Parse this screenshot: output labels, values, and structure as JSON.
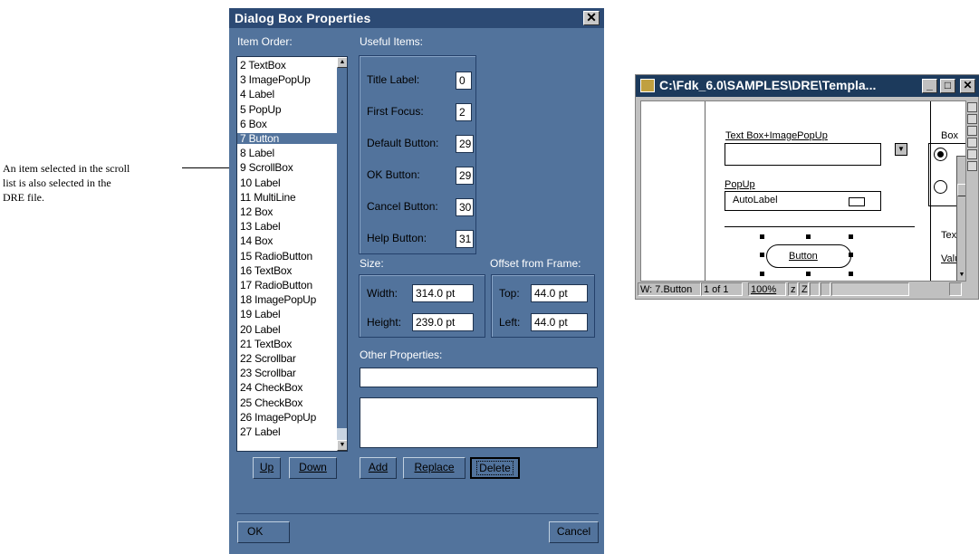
{
  "annotation": {
    "lines": [
      "An item selected in the scroll",
      "list is also selected in the",
      "DRE file."
    ]
  },
  "dialog": {
    "title": "Dialog Box Properties",
    "close_glyph": "✕",
    "item_order_label": "Item Order:",
    "list_items": [
      "2 TextBox",
      "3 ImagePopUp",
      "4 Label",
      "5 PopUp",
      "6 Box",
      "7 Button",
      "8 Label",
      "9 ScrollBox",
      "10 Label",
      "11 MultiLine",
      "12 Box",
      "13 Label",
      "14 Box",
      "15 RadioButton",
      "16 TextBox",
      "17 RadioButton",
      "18 ImagePopUp",
      "19 Label",
      "20 Label",
      "21 TextBox",
      "22 Scrollbar",
      "23 Scrollbar",
      "24 CheckBox",
      "25 CheckBox",
      "26 ImagePopUp",
      "27 Label"
    ],
    "selected_item": "7 Button",
    "useful_items_label": "Useful Items:",
    "useful_items": [
      {
        "label": "Title Label:",
        "value": "0"
      },
      {
        "label": "First Focus:",
        "value": "2"
      },
      {
        "label": "Default Button:",
        "value": "29"
      },
      {
        "label": "OK Button:",
        "value": "29"
      },
      {
        "label": "Cancel Button:",
        "value": "30"
      },
      {
        "label": "Help Button:",
        "value": "31"
      }
    ],
    "size_label": "Size:",
    "width_label": "Width:",
    "width_value": "314.0 pt",
    "height_label": "Height:",
    "height_value": "239.0 pt",
    "offset_label": "Offset from Frame:",
    "top_label": "Top:",
    "top_value": "44.0 pt",
    "left_label": "Left:",
    "left_value": "44.0 pt",
    "other_props_label": "Other Properties:",
    "other_props_value": "",
    "other_props_text": "",
    "buttons": {
      "up": "Up",
      "down": "Down",
      "add": "Add",
      "replace": "Replace",
      "delete": "Delete",
      "ok": "OK",
      "cancel": "Cancel"
    }
  },
  "doc_window": {
    "title": "C:\\Fdk_6.0\\SAMPLES\\DRE\\Templa...",
    "min_glyph": "_",
    "max_glyph": "□",
    "close_glyph": "✕",
    "textbox_label": "Text Box+ImagePopUp",
    "box_label": "Box",
    "popup_label": "PopUp",
    "autolabel_text": "AutoLabel",
    "button_text": "Button",
    "text_label": "Text",
    "value_label": "Valu",
    "status": {
      "element": "W:   7.Button",
      "page": "1 of 1",
      "zoom": "100%",
      "zoom_controls": [
        "z",
        "Z"
      ]
    }
  }
}
